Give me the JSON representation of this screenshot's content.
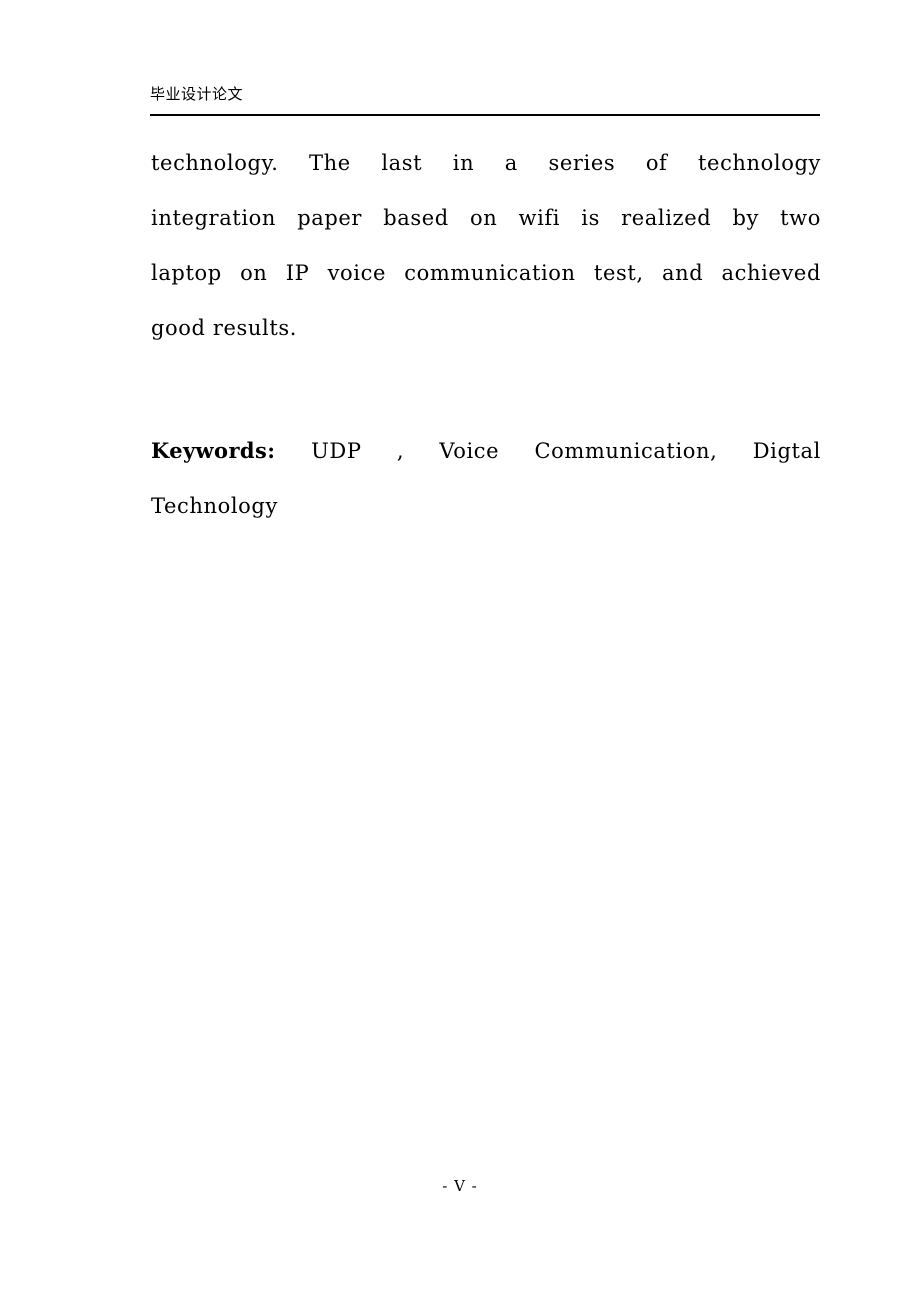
{
  "document": {
    "page_number_label": "- V -",
    "text_color": "#000000",
    "background_color": "#ffffff"
  },
  "header": {
    "title": "毕业设计论文"
  },
  "abstract": {
    "lines": [
      "technology. The last in a series of technology",
      "integration paper based on wifi is realized by two",
      "laptop on IP voice communication test, and achieved",
      "good results."
    ]
  },
  "keywords": {
    "label": "Keywords:",
    "lines": [
      "UDP , Voice Communication, Digtal",
      "Technology"
    ],
    "terms": [
      "UDP",
      "Voice Communication",
      "Digtal Technology"
    ]
  },
  "footer": {
    "page_number": "- V -"
  }
}
